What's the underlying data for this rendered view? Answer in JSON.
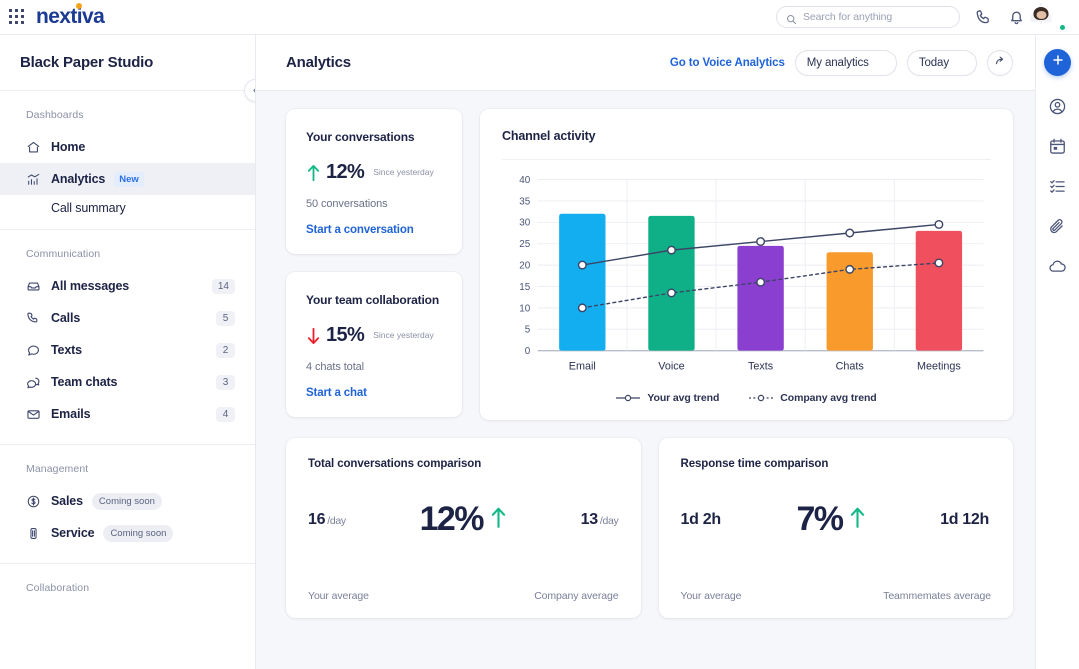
{
  "topbar": {
    "logo_text": "nextiva",
    "search": {
      "placeholder": "Search for anything",
      "value": ""
    },
    "icons": {
      "waffle": "apps-grid-icon",
      "search": "search-icon",
      "phone": "phone-icon",
      "bell": "bell-icon",
      "avatar": "user-avatar"
    }
  },
  "sidebar": {
    "workspace_title": "Black Paper Studio",
    "groups": [
      {
        "label": "Dashboards",
        "items": [
          {
            "label": "Home",
            "icon": "home-icon",
            "badge": "",
            "count": "",
            "active": false
          },
          {
            "label": "Analytics",
            "icon": "analytics-chart-icon",
            "badge": "New",
            "count": "",
            "active": true
          }
        ],
        "sub_items": [
          {
            "label": "Call summary"
          }
        ]
      },
      {
        "label": "Communication",
        "items": [
          {
            "label": "All messages",
            "icon": "inbox-icon",
            "badge": "",
            "count": "14",
            "active": false
          },
          {
            "label": "Calls",
            "icon": "phone-icon",
            "badge": "",
            "count": "5",
            "active": false
          },
          {
            "label": "Texts",
            "icon": "chat-bubble-icon",
            "badge": "",
            "count": "2",
            "active": false
          },
          {
            "label": "Team chats",
            "icon": "chats-icon",
            "badge": "",
            "count": "3",
            "active": false
          },
          {
            "label": "Emails",
            "icon": "envelope-icon",
            "badge": "",
            "count": "4",
            "active": false
          }
        ],
        "sub_items": []
      },
      {
        "label": "Management",
        "items": [
          {
            "label": "Sales",
            "icon": "dollar-circle-icon",
            "badge": "Coming soon",
            "count": "",
            "active": false
          },
          {
            "label": "Service",
            "icon": "service-icon",
            "badge": "Coming soon",
            "count": "",
            "active": false
          }
        ],
        "sub_items": []
      },
      {
        "label": "Collaboration",
        "items": [],
        "sub_items": []
      }
    ]
  },
  "main_header": {
    "page_title": "Analytics",
    "voice_link": "Go to Voice Analytics",
    "scope_filter": "My analytics",
    "date_filter": "Today",
    "share_icon": "share-arrow-icon"
  },
  "kpi_cards": [
    {
      "title": "Your conversations",
      "direction": "up",
      "percent": "12%",
      "since": "Since yesterday",
      "subtext": "50 conversations",
      "link": "Start a conversation",
      "accent": "#12b886"
    },
    {
      "title": "Your team collaboration",
      "direction": "down",
      "percent": "15%",
      "since": "Since yesterday",
      "subtext": "4 chats total",
      "link": "Start a chat",
      "accent": "#ee1f2a"
    }
  ],
  "chart_card": {
    "title": "Channel activity"
  },
  "chart_data": {
    "type": "bar",
    "title": "Channel activity",
    "categories": [
      "Email",
      "Voice",
      "Texts",
      "Chats",
      "Meetings"
    ],
    "values": [
      32,
      31.5,
      24.5,
      23,
      28
    ],
    "bar_colors": [
      "#13aef0",
      "#0fb087",
      "#8b3fd1",
      "#f99b2c",
      "#f0505e"
    ],
    "series": [
      {
        "name": "Your avg trend",
        "type": "line",
        "style": "solid",
        "color": "#3c4566",
        "values": [
          20,
          23.5,
          25.5,
          27.5,
          29.5
        ]
      },
      {
        "name": "Company avg trend",
        "type": "line",
        "style": "dotted",
        "color": "#3c4566",
        "values": [
          10,
          13.5,
          16,
          19,
          20.5
        ]
      }
    ],
    "yticks": [
      0,
      5,
      10,
      15,
      20,
      25,
      30,
      35,
      40
    ],
    "ylim": [
      0,
      40
    ],
    "xlabel": "",
    "ylabel": "",
    "grid": true,
    "legend_position": "bottom"
  },
  "compare_cards": [
    {
      "title": "Total conversations comparison",
      "left_value": "16",
      "left_unit": "/day",
      "center_value": "12%",
      "direction": "up",
      "right_value": "13",
      "right_unit": "/day",
      "left_label": "Your average",
      "right_label": "Company average"
    },
    {
      "title": "Response time comparison",
      "left_value": "1d 2h",
      "left_unit": "",
      "center_value": "7%",
      "direction": "up",
      "right_value": "1d 12h",
      "right_unit": "",
      "left_label": "Your average",
      "right_label": "Teammemates average"
    }
  ],
  "right_rail": {
    "items": [
      {
        "icon": "plus-icon",
        "primary": true
      },
      {
        "icon": "contact-person-icon",
        "primary": false
      },
      {
        "icon": "calendar-icon",
        "primary": false
      },
      {
        "icon": "task-list-icon",
        "primary": false
      },
      {
        "icon": "paperclip-icon",
        "primary": false
      },
      {
        "icon": "cloud-icon",
        "primary": false
      }
    ]
  },
  "colors": {
    "brand_blue": "#1b3a93",
    "link_blue": "#1f63d8",
    "accent_orange": "#f7a21b",
    "green": "#12b886",
    "red": "#ee1f2a"
  }
}
